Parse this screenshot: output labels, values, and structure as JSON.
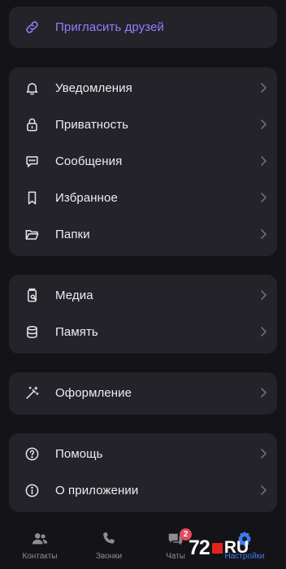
{
  "invite": {
    "label": "Пригласить друзей",
    "icon": "link-icon"
  },
  "groups": [
    {
      "items": [
        {
          "label": "Уведомления",
          "icon": "bell-icon"
        },
        {
          "label": "Приватность",
          "icon": "lock-icon"
        },
        {
          "label": "Сообщения",
          "icon": "message-icon"
        },
        {
          "label": "Избранное",
          "icon": "bookmark-icon"
        },
        {
          "label": "Папки",
          "icon": "folder-icon"
        }
      ]
    },
    {
      "items": [
        {
          "label": "Медиа",
          "icon": "media-icon"
        },
        {
          "label": "Память",
          "icon": "database-icon"
        }
      ]
    },
    {
      "items": [
        {
          "label": "Оформление",
          "icon": "magic-wand-icon"
        }
      ]
    },
    {
      "items": [
        {
          "label": "Помощь",
          "icon": "question-icon"
        },
        {
          "label": "О приложении",
          "icon": "info-icon"
        }
      ]
    }
  ],
  "tabbar": {
    "tabs": [
      {
        "label": "Контакты",
        "icon": "contacts-icon"
      },
      {
        "label": "Звонки",
        "icon": "phone-icon"
      },
      {
        "label": "Чаты",
        "icon": "chats-icon"
      },
      {
        "label": "Настройки",
        "icon": "settings-icon",
        "active": true
      }
    ],
    "chats_badge": "2"
  },
  "watermark": {
    "number": "72",
    "suffix": "RU"
  },
  "colors": {
    "background": "#141418",
    "card": "#232329",
    "accent": "#9a7cff",
    "active_tab": "#3f7bf2",
    "badge": "#e04b5e"
  }
}
